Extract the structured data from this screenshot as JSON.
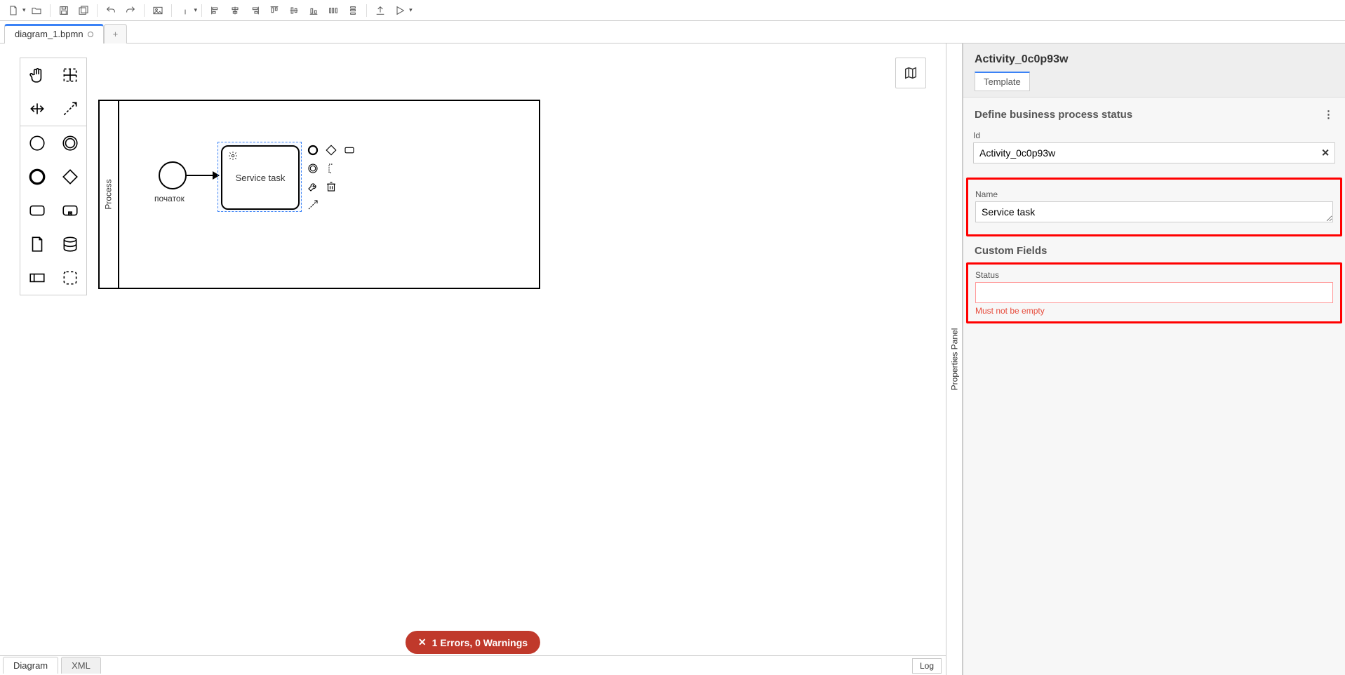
{
  "tabs": {
    "file": "diagram_1.bpmn",
    "add": "+"
  },
  "footer": {
    "diagram": "Diagram",
    "xml": "XML",
    "log": "Log"
  },
  "errors_pill": "1 Errors, 0 Warnings",
  "pool_label": "Process",
  "start_label": "початок",
  "task_label": "Service task",
  "props": {
    "title": "Activity_0c0p93w",
    "tab": "Template",
    "section1": "Define business process status",
    "id_label": "Id",
    "id_value": "Activity_0c0p93w",
    "name_label": "Name",
    "name_value": "Service task",
    "section2": "Custom Fields",
    "status_label": "Status",
    "status_value": "",
    "status_error": "Must not be empty"
  },
  "side_handle": "Properties Panel"
}
